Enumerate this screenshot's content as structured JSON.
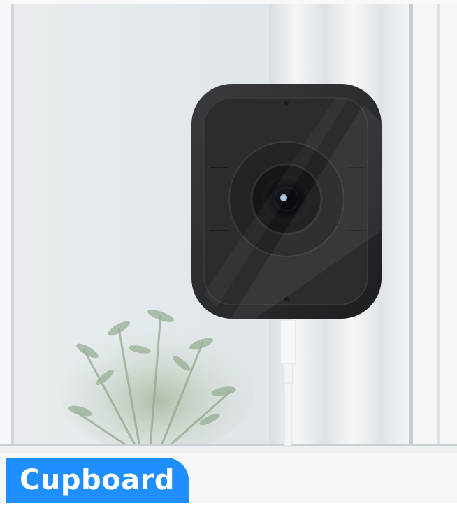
{
  "caption": {
    "label": "Cupboard"
  },
  "colors": {
    "label_background": "#1f8fff",
    "label_text": "#ffffff",
    "camera_body": "#2a2b2e",
    "wall": "#e8ecef",
    "window_frame": "#f3f5f7",
    "plant": "#8fa888"
  },
  "icons": [
    "security-camera-icon"
  ]
}
